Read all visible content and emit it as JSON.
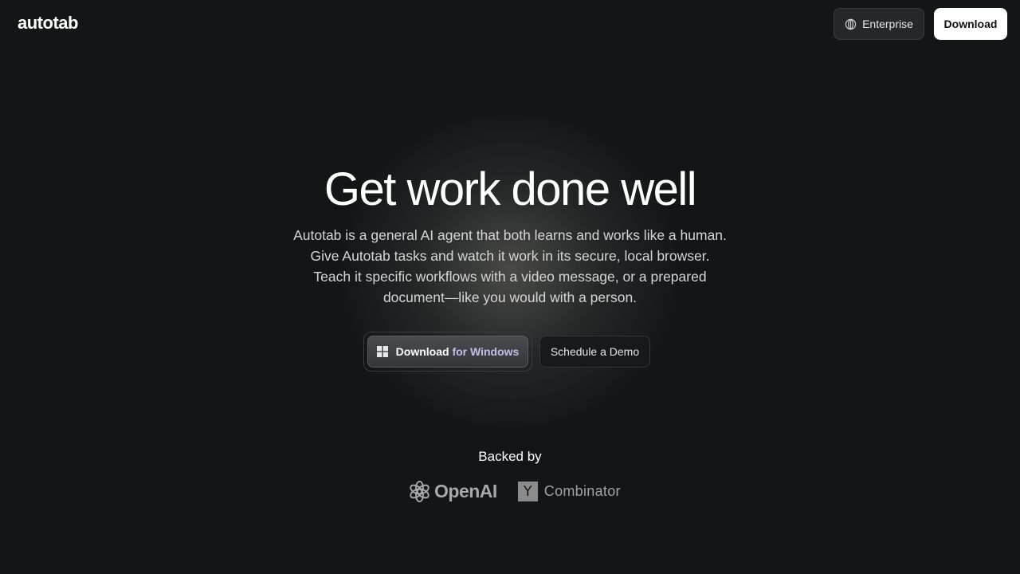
{
  "header": {
    "logo": "autotab",
    "enterprise_label": "Enterprise",
    "download_label": "Download"
  },
  "hero": {
    "title": "Get work done well",
    "description_lines": [
      "Autotab is a general AI agent that both learns and works like a human.",
      "Give Autotab tasks and watch it work in its secure, local browser.",
      "Teach it specific workflows with a video message, or a prepared",
      "document—like you would with a person."
    ],
    "cta_primary_part1": "Download ",
    "cta_primary_part2": "for Windows",
    "cta_secondary": "Schedule a Demo"
  },
  "backers": {
    "heading": "Backed by",
    "openai": "OpenAI",
    "yc_letter": "Y",
    "yc_name": "Combinator"
  },
  "icons": {
    "enterprise": "globe-icon",
    "cta": "windows-icon",
    "openai": "openai-logo-icon"
  },
  "colors": {
    "background": "#131517",
    "accent_text": "#c5bde8",
    "primary_button": "#ffffff"
  }
}
